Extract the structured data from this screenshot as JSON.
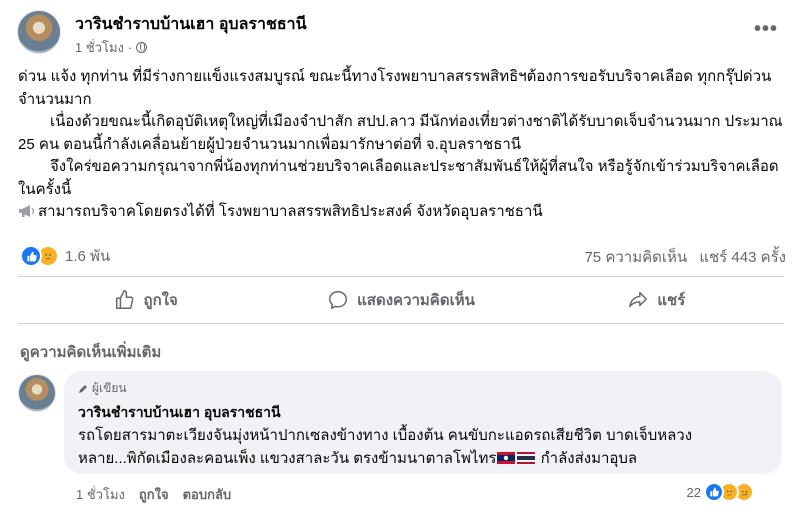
{
  "post": {
    "author": "วารินชำราบบ้านเฮา อุบลราชธานี",
    "time": "1 ชั่วโมง",
    "separator": "·",
    "body": {
      "line1": "ด่วน แจ้ง ทุกท่าน ที่มีร่างกายแข็งแรงสมบูรณ์ ขณะนี้ทางโรงพยาบาลสรรพสิทธิฯต้องการขอรับบริจาคเลือด ทุกกรุ๊ปด่วน จำนวนมาก",
      "line2": "เนื่องด้วยขณะนี้เกิดอุบัติเหตุใหญ่ที่เมืองจำปาสัก สปป.ลาว มีนักท่องเที่ยวต่างชาติได้รับบาดเจ็บจำนวนมาก ประมาณ 25 คน ตอนนี้กำลังเคลื่อนย้ายผู้ป่วยจำนวนมากเพื่อมารักษาต่อที่ จ.อุบลราชธานี",
      "line3": "จึงใคร่ขอความกรุณาจากพี่น้องทุกท่านช่วยบริจาคเลือดและประชาสัมพันธ์ให้ผู้ที่สนใจ หรือรู้จักเข้าร่วมบริจาคเลือดในครั้งนี้",
      "line4": "สามารถบริจาคโดยตรงได้ที่ โรงพยาบาลสรรพสิทธิประสงค์ จังหวัดอุบลราชธานี"
    },
    "stats": {
      "reactions_count": "1.6 พัน",
      "comments": "75 ความคิดเห็น",
      "shares": "แชร์ 443 ครั้ง"
    },
    "actions": {
      "like": "ถูกใจ",
      "comment": "แสดงความคิดเห็น",
      "share": "แชร์"
    }
  },
  "more_comments": "ดูความคิดเห็นเพิ่มเติม",
  "comment": {
    "badge": "ผู้เขียน",
    "author": "วารินชำราบบ้านเฮา อุบลราชธานี",
    "text_part1": "รถโดยสารมาตะเวียงจันมุ่งหน้าปากเซลงข้างทาง เบื้องต้น คนขับกะแอดรถเสียชีวิต บาดเจ็บหลวงหลาย...พิกัดเมืองละคอนเพ็ง แขวงสาละวัน ตรงข้ามนาตาลโพไทร",
    "text_part2": "กำลังส่งมาอุบล",
    "time": "1 ชั่วโมง",
    "like": "ถูกใจ",
    "reply": "ตอบกลับ",
    "reaction_count": "22"
  },
  "colors": {
    "accent": "#1877f2",
    "muted_text": "#65676b",
    "bubble_bg": "#f0f2f5"
  }
}
